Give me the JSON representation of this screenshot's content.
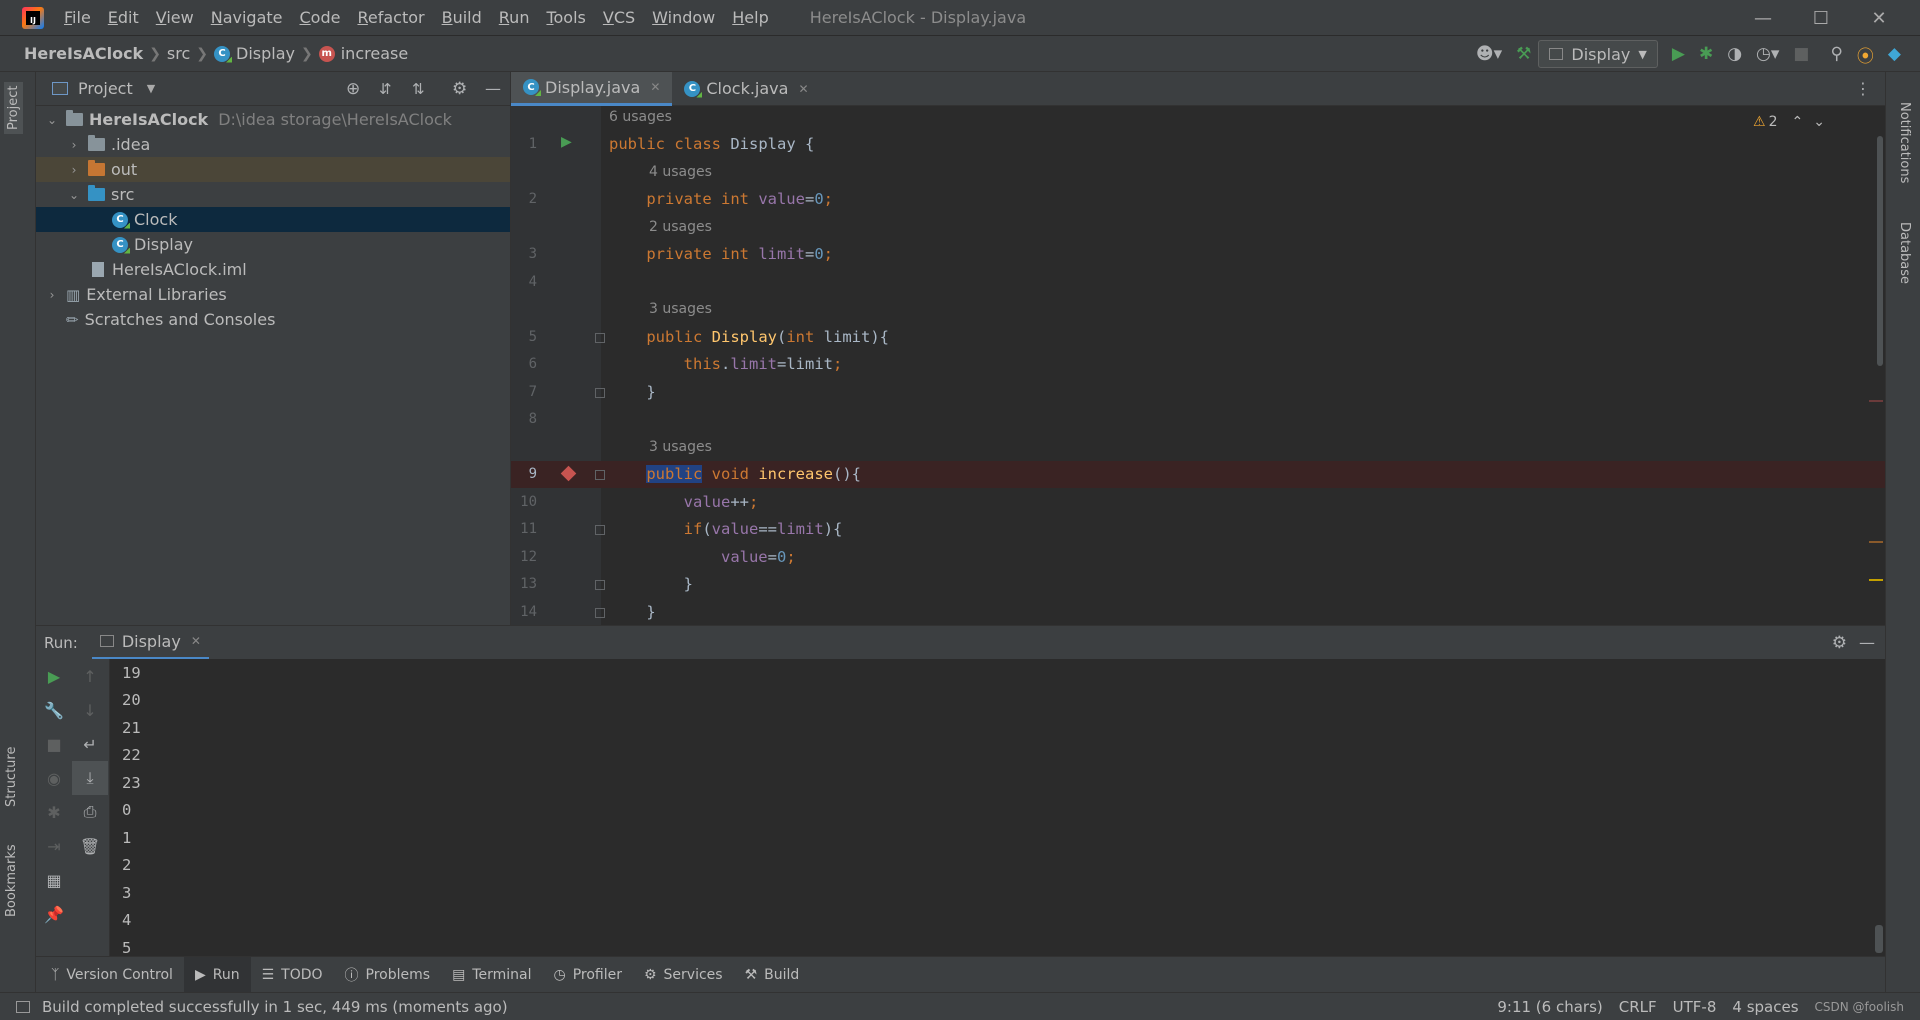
{
  "window": {
    "title": "HereIsAClock - Display.java",
    "menu": [
      "File",
      "Edit",
      "View",
      "Navigate",
      "Code",
      "Refactor",
      "Build",
      "Run",
      "Tools",
      "VCS",
      "Window",
      "Help"
    ]
  },
  "breadcrumb": {
    "project": "HereIsAClock",
    "folder": "src",
    "class": "Display",
    "method": "increase"
  },
  "toolbar": {
    "run_config": "Display"
  },
  "project_panel": {
    "title": "Project",
    "tree": [
      {
        "label": "HereIsAClock",
        "note": "D:\\idea storage\\HereIsAClock"
      },
      {
        "label": ".idea"
      },
      {
        "label": "out"
      },
      {
        "label": "src"
      },
      {
        "label": "Clock"
      },
      {
        "label": "Display"
      },
      {
        "label": "HereIsAClock.iml"
      },
      {
        "label": "External Libraries"
      },
      {
        "label": "Scratches and Consoles"
      }
    ]
  },
  "editor": {
    "tabs": [
      "Display.java",
      "Clock.java"
    ],
    "warnings": "2",
    "hints": {
      "class_usages": "6 usages",
      "value_usages": "4 usages",
      "limit_usages": "2 usages",
      "ctor_usages": "3 usages",
      "increase_usages": "3 usages"
    },
    "line_numbers": [
      "1",
      "2",
      "3",
      "4",
      "5",
      "6",
      "7",
      "8",
      "9",
      "10",
      "11",
      "12",
      "13",
      "14"
    ]
  },
  "run_panel": {
    "label": "Run:",
    "tab": "Display",
    "output": [
      "19",
      "20",
      "21",
      "22",
      "23",
      "0",
      "1",
      "2",
      "3",
      "4",
      "5"
    ]
  },
  "bottom_tabs": [
    "Version Control",
    "Run",
    "TODO",
    "Problems",
    "Terminal",
    "Profiler",
    "Services",
    "Build"
  ],
  "left_strip": {
    "project": "Project",
    "structure": "Structure",
    "bookmarks": "Bookmarks"
  },
  "right_strip": {
    "notifications": "Notifications",
    "database": "Database"
  },
  "status_bar": {
    "message": "Build completed successfully in 1 sec, 449 ms (moments ago)",
    "position": "9:11 (6 chars)",
    "line_sep": "CRLF",
    "encoding": "UTF-8",
    "indent": "4 spaces",
    "watermark": "CSDN @foolish"
  },
  "colors": {
    "accent": "#4a88c7",
    "keyword": "#cc7832",
    "field": "#9876aa",
    "number": "#6897bb",
    "function": "#ffc66d",
    "run_green": "#499c54",
    "breakpoint": "#c75450"
  }
}
